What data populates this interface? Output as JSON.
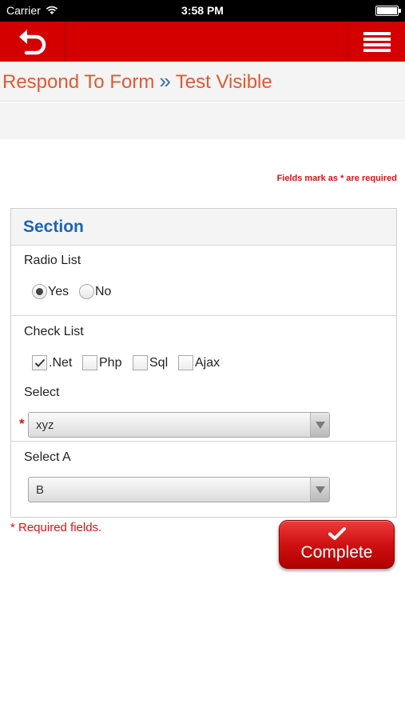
{
  "status_bar": {
    "carrier": "Carrier",
    "time": "3:58 PM"
  },
  "header": {
    "back_icon": "back-arrow-icon",
    "menu_icon": "hamburger-menu-icon",
    "brand_color": "#d40000"
  },
  "breadcrumb": {
    "root": "Respond To Form",
    "separator": "»",
    "current": "Test Visible"
  },
  "required_note": "Fields mark as * are required",
  "section": {
    "title": "Section",
    "radio_list": {
      "label": "Radio List",
      "options": [
        {
          "label": "Yes",
          "selected": true
        },
        {
          "label": "No",
          "selected": false
        }
      ]
    },
    "check_list": {
      "label": "Check List",
      "options": [
        {
          "label": ".Net",
          "checked": true
        },
        {
          "label": "Php",
          "checked": false
        },
        {
          "label": "Sql",
          "checked": false
        },
        {
          "label": "Ajax",
          "checked": false
        }
      ]
    },
    "select": {
      "label": "Select",
      "required_mark": "*",
      "value": "xyz"
    },
    "select_a": {
      "label": "Select A",
      "value": "B"
    }
  },
  "footer": {
    "required_fields": "* Required fields.",
    "complete_label": "Complete"
  }
}
